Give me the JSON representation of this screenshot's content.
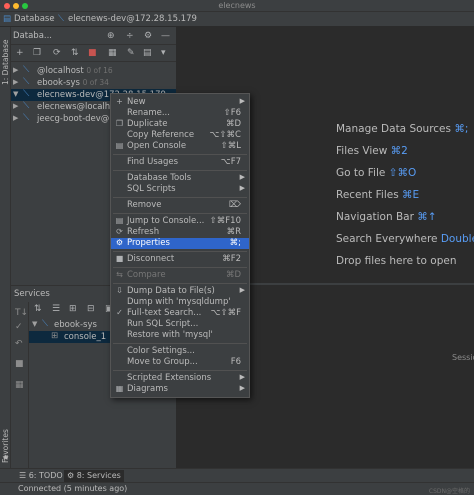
{
  "window": {
    "title": "elecnews",
    "traffic_lights": [
      "#ff5f57",
      "#febc2e",
      "#28c840"
    ]
  },
  "navbar": {
    "crumbs": [
      "Database",
      "elecnews-dev@172.28.15.179"
    ]
  },
  "left_strip": {
    "top_label": "1: Database",
    "bottom_label": "Favorites",
    "star": "★"
  },
  "database_panel": {
    "title": "Databa...",
    "header_icons": [
      "⊕",
      "÷",
      "⚙",
      "—"
    ],
    "toolbar_icons": [
      "+",
      "❐",
      "⟳",
      "⇅",
      "■",
      "▦",
      "✎",
      "▤",
      "▾"
    ],
    "tree": [
      {
        "arrow": "▶",
        "icon": "⟍",
        "label": "@localhost",
        "count": "0 of 16",
        "selected": false
      },
      {
        "arrow": "▶",
        "icon": "⟍",
        "label": "ebook-sys",
        "count": "0 of 34",
        "selected": false
      },
      {
        "arrow": "▼",
        "icon": "⟍",
        "label": "elecnews-dev@172.28.15.179",
        "count": "",
        "selected": true
      },
      {
        "arrow": "▶",
        "icon": "⟍",
        "label": "elecnews@localhos",
        "count": "",
        "selected": false
      },
      {
        "arrow": "▶",
        "icon": "⟍",
        "label": "jeecg-boot-dev@17",
        "count": "",
        "selected": false
      }
    ]
  },
  "services_panel": {
    "title": "Services",
    "toolbar_icons": [
      "⇅",
      "☰",
      "⊞",
      "⊟",
      "▣"
    ],
    "side_icons": [
      "T↓",
      "✓",
      "↶",
      "■",
      "▦"
    ],
    "rows": [
      {
        "arrow": "▼",
        "icon": "⟍",
        "label": "ebook-sys",
        "selected": false
      },
      {
        "arrow": "",
        "icon": "⊞",
        "label": "console_1",
        "selected": true
      }
    ]
  },
  "editor": {
    "hints": [
      {
        "text": "Manage Data Sources",
        "key": "⌘;"
      },
      {
        "text": "Files View",
        "key": "⌘2"
      },
      {
        "text": "Go to File",
        "key": "⇧⌘O"
      },
      {
        "text": "Recent Files",
        "key": "⌘E"
      },
      {
        "text": "Navigation Bar",
        "key": "⌘↑"
      },
      {
        "text": "Search Everywhere",
        "key": "Double ⇧"
      },
      {
        "text": "Drop files here to open",
        "key": ""
      }
    ],
    "session_label": "Sessio"
  },
  "context_menu": {
    "items": [
      {
        "icon": "+",
        "label": "New",
        "shortcut": "",
        "submenu": true,
        "state": "normal"
      },
      {
        "icon": "",
        "label": "Rename...",
        "shortcut": "⇧F6",
        "submenu": false,
        "state": "normal"
      },
      {
        "icon": "❐",
        "label": "Duplicate",
        "shortcut": "⌘D",
        "submenu": false,
        "state": "normal"
      },
      {
        "icon": "",
        "label": "Copy Reference",
        "shortcut": "⌥⇧⌘C",
        "submenu": false,
        "state": "normal"
      },
      {
        "icon": "▤",
        "label": "Open Console",
        "shortcut": "⇧⌘L",
        "submenu": false,
        "state": "normal"
      },
      {
        "sep": true
      },
      {
        "icon": "",
        "label": "Find Usages",
        "shortcut": "⌥F7",
        "submenu": false,
        "state": "normal"
      },
      {
        "sep": true
      },
      {
        "icon": "",
        "label": "Database Tools",
        "shortcut": "",
        "submenu": true,
        "state": "normal"
      },
      {
        "icon": "",
        "label": "SQL Scripts",
        "shortcut": "",
        "submenu": true,
        "state": "normal"
      },
      {
        "sep": true
      },
      {
        "icon": "",
        "label": "Remove",
        "shortcut": "⌦",
        "submenu": false,
        "state": "normal"
      },
      {
        "sep": true
      },
      {
        "icon": "▤",
        "label": "Jump to Console...",
        "shortcut": "⇧⌘F10",
        "submenu": false,
        "state": "normal"
      },
      {
        "icon": "⟳",
        "label": "Refresh",
        "shortcut": "⌘R",
        "submenu": false,
        "state": "normal"
      },
      {
        "icon": "⚙",
        "label": "Properties",
        "shortcut": "⌘;",
        "submenu": false,
        "state": "highlight"
      },
      {
        "sep": true
      },
      {
        "icon": "■",
        "label": "Disconnect",
        "shortcut": "⌘F2",
        "submenu": false,
        "state": "normal"
      },
      {
        "sep": true
      },
      {
        "icon": "⇆",
        "label": "Compare",
        "shortcut": "⌘D",
        "submenu": false,
        "state": "disabled"
      },
      {
        "sep": true
      },
      {
        "icon": "⇩",
        "label": "Dump Data to File(s)",
        "shortcut": "",
        "submenu": true,
        "state": "normal"
      },
      {
        "icon": "",
        "label": "Dump with 'mysqldump'",
        "shortcut": "",
        "submenu": false,
        "state": "normal"
      },
      {
        "icon": "✓",
        "label": "Full-text Search...",
        "shortcut": "⌥⇧⌘F",
        "submenu": false,
        "state": "normal"
      },
      {
        "icon": "",
        "label": "Run SQL Script...",
        "shortcut": "",
        "submenu": false,
        "state": "normal"
      },
      {
        "icon": "",
        "label": "Restore with 'mysql'",
        "shortcut": "",
        "submenu": false,
        "state": "normal"
      },
      {
        "sep": true
      },
      {
        "icon": "",
        "label": "Color Settings...",
        "shortcut": "",
        "submenu": false,
        "state": "normal"
      },
      {
        "icon": "",
        "label": "Move to Group...",
        "shortcut": "F6",
        "submenu": false,
        "state": "normal"
      },
      {
        "sep": true
      },
      {
        "icon": "",
        "label": "Scripted Extensions",
        "shortcut": "",
        "submenu": true,
        "state": "normal"
      },
      {
        "icon": "▦",
        "label": "Diagrams",
        "shortcut": "",
        "submenu": true,
        "state": "normal"
      }
    ]
  },
  "bottom_tabs": [
    {
      "icon": "☰",
      "label": "6: TODO",
      "active": false
    },
    {
      "icon": "⚙",
      "label": "8: Services",
      "active": true
    }
  ],
  "status": {
    "text": "Connected (5 minutes ago)",
    "watermark": "CSDN@空格的"
  },
  "submenu_arrow": "▶"
}
